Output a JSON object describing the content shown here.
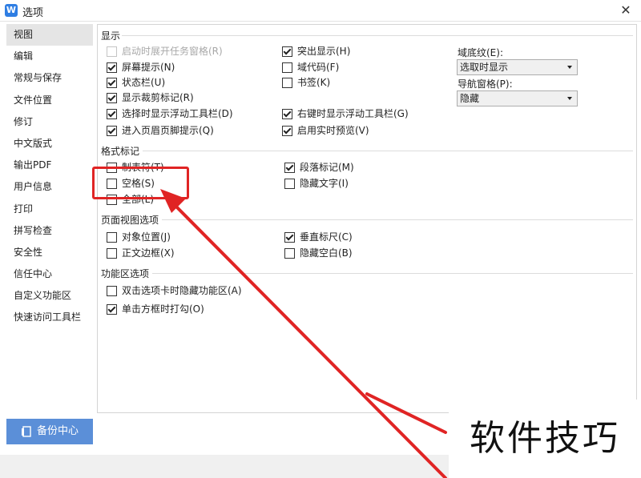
{
  "window": {
    "title": "选项",
    "app_icon": "W"
  },
  "sidebar": {
    "items": [
      {
        "label": "视图",
        "active": true
      },
      {
        "label": "编辑"
      },
      {
        "label": "常规与保存"
      },
      {
        "label": "文件位置"
      },
      {
        "label": "修订"
      },
      {
        "label": "中文版式"
      },
      {
        "label": "输出PDF"
      },
      {
        "label": "用户信息"
      },
      {
        "label": "打印"
      },
      {
        "label": "拼写检查"
      },
      {
        "label": "安全性"
      },
      {
        "label": "信任中心"
      },
      {
        "label": "自定义功能区"
      },
      {
        "label": "快速访问工具栏"
      }
    ],
    "backup_label": "备份中心"
  },
  "display": {
    "title": "显示",
    "col1": [
      {
        "label": "启动时展开任务窗格(R)",
        "checked": false,
        "disabled": true
      },
      {
        "label": "屏幕提示(N)",
        "checked": true
      },
      {
        "label": "状态栏(U)",
        "checked": true
      },
      {
        "label": "显示裁剪标记(R)",
        "checked": true
      },
      {
        "label": "选择时显示浮动工具栏(D)",
        "checked": true
      },
      {
        "label": "进入页眉页脚提示(Q)",
        "checked": true
      }
    ],
    "col2": [
      {
        "label": "突出显示(H)",
        "checked": true
      },
      {
        "label": "域代码(F)",
        "checked": false
      },
      {
        "label": "书签(K)",
        "checked": false
      },
      {
        "label": "右键时显示浮动工具栏(G)",
        "checked": true
      },
      {
        "label": "启用实时预览(V)",
        "checked": true
      }
    ],
    "field_shading_label": "域底纹(E):",
    "field_shading_value": "选取时显示",
    "nav_pane_label": "导航窗格(P):",
    "nav_pane_value": "隐藏"
  },
  "format_marks": {
    "title": "格式标记",
    "items": [
      {
        "label": "制表符(T)",
        "checked": false
      },
      {
        "label": "段落标记(M)",
        "checked": true
      },
      {
        "label": "空格(S)",
        "checked": false
      },
      {
        "label": "隐藏文字(I)",
        "checked": false
      },
      {
        "label": "全部(L)",
        "checked": false
      }
    ]
  },
  "page_view": {
    "title": "页面视图选项",
    "items": [
      {
        "label": "对象位置(J)",
        "checked": false
      },
      {
        "label": "垂直标尺(C)",
        "checked": true
      },
      {
        "label": "正文边框(X)",
        "checked": false
      },
      {
        "label": "隐藏空白(B)",
        "checked": false
      }
    ]
  },
  "ribbon": {
    "title": "功能区选项",
    "items": [
      {
        "label": "双击选项卡时隐藏功能区(A)",
        "checked": false
      },
      {
        "label": "单击方框时打勾(O)",
        "checked": true
      }
    ]
  },
  "annotation": {
    "color": "#e02424"
  },
  "watermark": {
    "text": "软件技巧"
  }
}
